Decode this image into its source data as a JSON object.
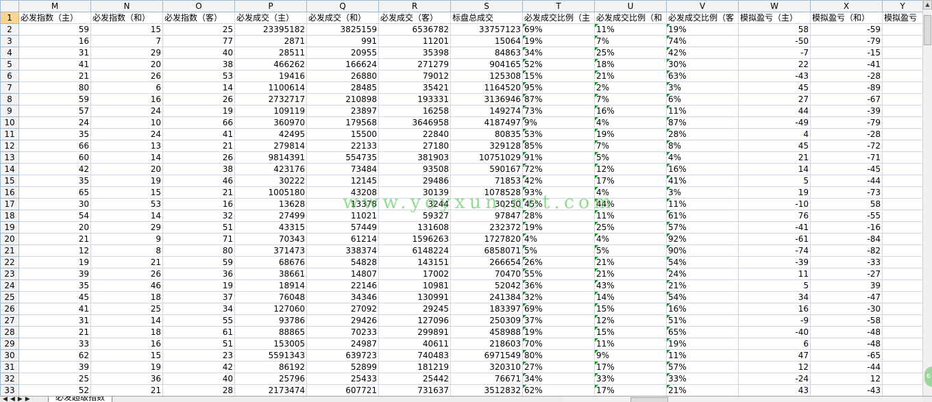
{
  "columns": [
    "M",
    "N",
    "O",
    "P",
    "Q",
    "R",
    "S",
    "T",
    "U",
    "V",
    "W",
    "X",
    "Y"
  ],
  "row_numbers": [
    "1",
    "2",
    "3",
    "4",
    "5",
    "6",
    "7",
    "8",
    "9",
    "10",
    "11",
    "12",
    "13",
    "14",
    "15",
    "16",
    "17",
    "18",
    "19",
    "20",
    "21",
    "22",
    "23",
    "24",
    "25",
    "26",
    "27",
    "28",
    "29",
    "30",
    "31",
    "32",
    "33"
  ],
  "header_row": [
    "必发指数（主）",
    "必发指数（和）",
    "必发指数（客）",
    "必发成交（主）",
    "必发成交（和）",
    "必发成交（客）",
    "标盘总成交",
    "必发成交比例（主",
    "必发成交比例（和",
    "必发成交比例（客",
    "模拟盈亏（主）",
    "模拟盈亏（和）",
    "模拟盈亏"
  ],
  "rows": [
    [
      "59",
      "15",
      "25",
      "23395182",
      "3825159",
      "6536782",
      "33757123",
      "69%",
      "11%",
      "19%",
      "58",
      "-59"
    ],
    [
      "16",
      "7",
      "77",
      "2871",
      "991",
      "11201",
      "15064",
      "19%",
      "7%",
      "74%",
      "-50",
      "-79"
    ],
    [
      "31",
      "29",
      "40",
      "28511",
      "20955",
      "35398",
      "84863",
      "34%",
      "25%",
      "42%",
      "-7",
      "-15"
    ],
    [
      "41",
      "20",
      "38",
      "466262",
      "166624",
      "271279",
      "904165",
      "52%",
      "18%",
      "30%",
      "22",
      "-41"
    ],
    [
      "21",
      "26",
      "53",
      "19416",
      "26880",
      "79012",
      "125308",
      "15%",
      "21%",
      "63%",
      "-43",
      "-28"
    ],
    [
      "80",
      "6",
      "14",
      "1100614",
      "28485",
      "35421",
      "1164520",
      "95%",
      "2%",
      "3%",
      "45",
      "-89"
    ],
    [
      "59",
      "16",
      "26",
      "2732717",
      "210898",
      "193331",
      "3136946",
      "87%",
      "7%",
      "6%",
      "27",
      "-67"
    ],
    [
      "57",
      "24",
      "19",
      "109119",
      "23897",
      "16258",
      "149274",
      "73%",
      "16%",
      "11%",
      "44",
      "-39"
    ],
    [
      "24",
      "10",
      "66",
      "360970",
      "179568",
      "3646958",
      "4187497",
      "9%",
      "4%",
      "87%",
      "-49",
      "-79"
    ],
    [
      "35",
      "24",
      "41",
      "42495",
      "15500",
      "22840",
      "80835",
      "53%",
      "19%",
      "28%",
      "4",
      "-28"
    ],
    [
      "66",
      "13",
      "21",
      "279814",
      "22133",
      "27180",
      "329128",
      "85%",
      "7%",
      "8%",
      "45",
      "-72"
    ],
    [
      "60",
      "14",
      "26",
      "9814391",
      "554735",
      "381903",
      "10751029",
      "91%",
      "5%",
      "4%",
      "21",
      "-71"
    ],
    [
      "42",
      "20",
      "38",
      "423176",
      "73484",
      "93508",
      "590167",
      "72%",
      "12%",
      "16%",
      "14",
      "-45"
    ],
    [
      "35",
      "19",
      "46",
      "30222",
      "12145",
      "29486",
      "71853",
      "42%",
      "17%",
      "41%",
      "5",
      "-44"
    ],
    [
      "65",
      "15",
      "21",
      "1005180",
      "43208",
      "30139",
      "1078528",
      "93%",
      "4%",
      "3%",
      "19",
      "-73"
    ],
    [
      "30",
      "53",
      "16",
      "13628",
      "13378",
      "3244",
      "30250",
      "45%",
      "44%",
      "11%",
      "-10",
      "58"
    ],
    [
      "54",
      "14",
      "32",
      "27499",
      "11021",
      "59327",
      "97847",
      "28%",
      "11%",
      "61%",
      "76",
      "-55"
    ],
    [
      "20",
      "29",
      "51",
      "43315",
      "57449",
      "131608",
      "232372",
      "19%",
      "25%",
      "57%",
      "-41",
      "-16"
    ],
    [
      "21",
      "9",
      "71",
      "70343",
      "61214",
      "1596263",
      "1727820",
      "4%",
      "4%",
      "92%",
      "-61",
      "-84"
    ],
    [
      "12",
      "8",
      "80",
      "371473",
      "338374",
      "6148224",
      "6858071",
      "5%",
      "5%",
      "90%",
      "-74",
      "-82"
    ],
    [
      "19",
      "21",
      "59",
      "68676",
      "54828",
      "143151",
      "266654",
      "26%",
      "21%",
      "54%",
      "-39",
      "-33"
    ],
    [
      "39",
      "26",
      "36",
      "38661",
      "14807",
      "17002",
      "70470",
      "55%",
      "21%",
      "24%",
      "11",
      "-27"
    ],
    [
      "35",
      "46",
      "19",
      "18914",
      "22146",
      "10981",
      "52042",
      "36%",
      "43%",
      "21%",
      "5",
      "39"
    ],
    [
      "45",
      "18",
      "37",
      "76048",
      "34346",
      "130991",
      "241384",
      "32%",
      "14%",
      "54%",
      "34",
      "-47"
    ],
    [
      "41",
      "25",
      "34",
      "127060",
      "27092",
      "29245",
      "183397",
      "69%",
      "15%",
      "16%",
      "16",
      "-30"
    ],
    [
      "31",
      "14",
      "55",
      "93786",
      "29426",
      "127096",
      "250309",
      "37%",
      "12%",
      "51%",
      "-9",
      "-58"
    ],
    [
      "21",
      "18",
      "61",
      "88865",
      "70233",
      "299891",
      "458988",
      "19%",
      "15%",
      "65%",
      "-40",
      "-48"
    ],
    [
      "33",
      "16",
      "51",
      "153005",
      "24987",
      "40611",
      "218603",
      "70%",
      "11%",
      "19%",
      "6",
      "-48"
    ],
    [
      "62",
      "15",
      "23",
      "5591343",
      "639723",
      "740483",
      "6971549",
      "80%",
      "9%",
      "11%",
      "47",
      "-65"
    ],
    [
      "39",
      "19",
      "42",
      "86192",
      "52899",
      "181219",
      "320310",
      "27%",
      "17%",
      "57%",
      "12",
      "-44"
    ],
    [
      "25",
      "36",
      "40",
      "25796",
      "25433",
      "25442",
      "76671",
      "34%",
      "33%",
      "33%",
      "-24",
      "12"
    ],
    [
      "52",
      "21",
      "28",
      "2173474",
      "607721",
      "731637",
      "3512832",
      "62%",
      "17%",
      "21%",
      "43",
      "-43"
    ]
  ],
  "sheet_tab": "必发超级指数",
  "watermark": "www.yoyxun.net.com",
  "corner_badge": "6"
}
